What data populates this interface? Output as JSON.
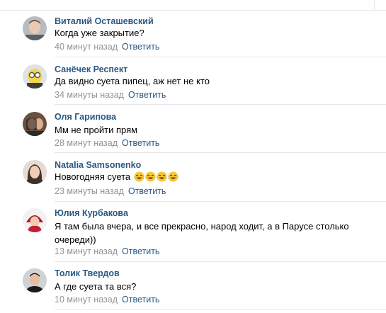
{
  "comments": [
    {
      "author": "Виталий Осташевский",
      "text": "Когда уже закрытие?",
      "time": "40 минут назад",
      "reply": "Ответить"
    },
    {
      "author": "Санёчек Респект",
      "text": "Да видно суета пипец, аж нет не кто",
      "time": "34 минуты назад",
      "reply": "Ответить"
    },
    {
      "author": "Оля Гарипова",
      "text": "Мм не пройти прям",
      "time": "28 минут назад",
      "reply": "Ответить"
    },
    {
      "author": "Natalia Samsonenko",
      "text": "Новогодняя суета",
      "emoji": [
        "laughing-tears-icon",
        "laughing-tears-icon",
        "laughing-tears-icon",
        "laughing-tears-icon"
      ],
      "time": "23 минуты назад",
      "reply": "Ответить"
    },
    {
      "author": "Юлия Курбакова",
      "text": "Я там была вчера, и все прекрасно, народ ходит, а в Парусе столько очереди))",
      "time": "13 минут назад",
      "reply": "Ответить"
    },
    {
      "author": "Толик Твердов",
      "text": "А где суета та вся?",
      "time": "10 минут назад",
      "reply": "Ответить"
    }
  ],
  "colors": {
    "link": "#2a5885",
    "meta": "#939393",
    "separator": "#e7e8ec"
  }
}
